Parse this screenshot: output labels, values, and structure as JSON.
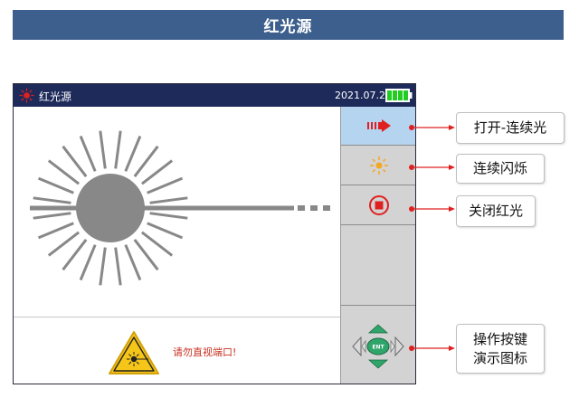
{
  "banner": {
    "title": "红光源"
  },
  "device": {
    "header": {
      "title": "红光源",
      "date": "2021.07.20"
    },
    "warning_text": "请勿直视端口!",
    "sidebar": [
      {
        "icon": "red-light-on-arrow-icon",
        "active": true
      },
      {
        "icon": "flash-icon",
        "active": false
      },
      {
        "icon": "stop-icon",
        "active": false
      }
    ],
    "dpad": {
      "center_label": "ENT"
    }
  },
  "callouts": {
    "open_continuous": "打开-连续光",
    "continuous_flash": "连续闪烁",
    "close_red_light": "关闭红光",
    "key_demo_line1": "操作按键",
    "key_demo_line2": "演示图标"
  },
  "colors": {
    "banner": "#3d5f8d",
    "header": "#1e2a5a",
    "accent_red": "#e02020",
    "active_button": "#b5d4ef",
    "battery": "#22cc22"
  }
}
